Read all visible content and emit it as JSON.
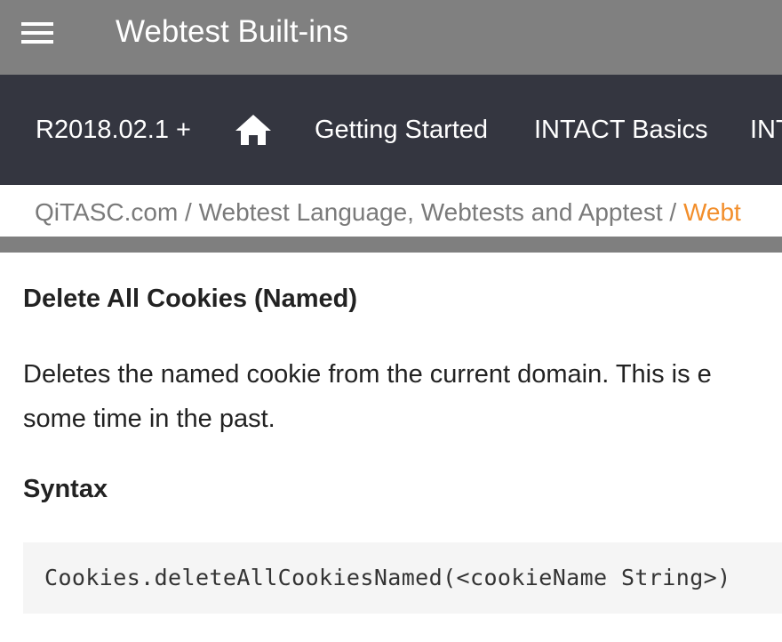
{
  "app_bar": {
    "menu_icon": "hamburger-menu-icon",
    "title": "Webtest Built-ins"
  },
  "nav": {
    "version": "R2018.02.1 +",
    "home_icon": "home-icon",
    "items": [
      {
        "label": "Getting Started"
      },
      {
        "label": "INTACT Basics"
      },
      {
        "label": "INT"
      }
    ]
  },
  "breadcrumb": {
    "links": [
      "QiTASC.com",
      "Webtest Language, Webtests and Apptest"
    ],
    "separator": " / ",
    "current": "Webt",
    "current_color": "#f28e2b"
  },
  "content": {
    "heading": "Delete All Cookies (Named)",
    "description_line1": "Deletes the named cookie from the current domain. This is e",
    "description_line2": "some time in the past.",
    "syntax_heading": "Syntax",
    "code": "Cookies.deleteAllCookiesNamed(<cookieName String>)"
  },
  "colors": {
    "app_bar": "#808080",
    "nav_bar": "#343640",
    "accent": "#f28e2b"
  }
}
